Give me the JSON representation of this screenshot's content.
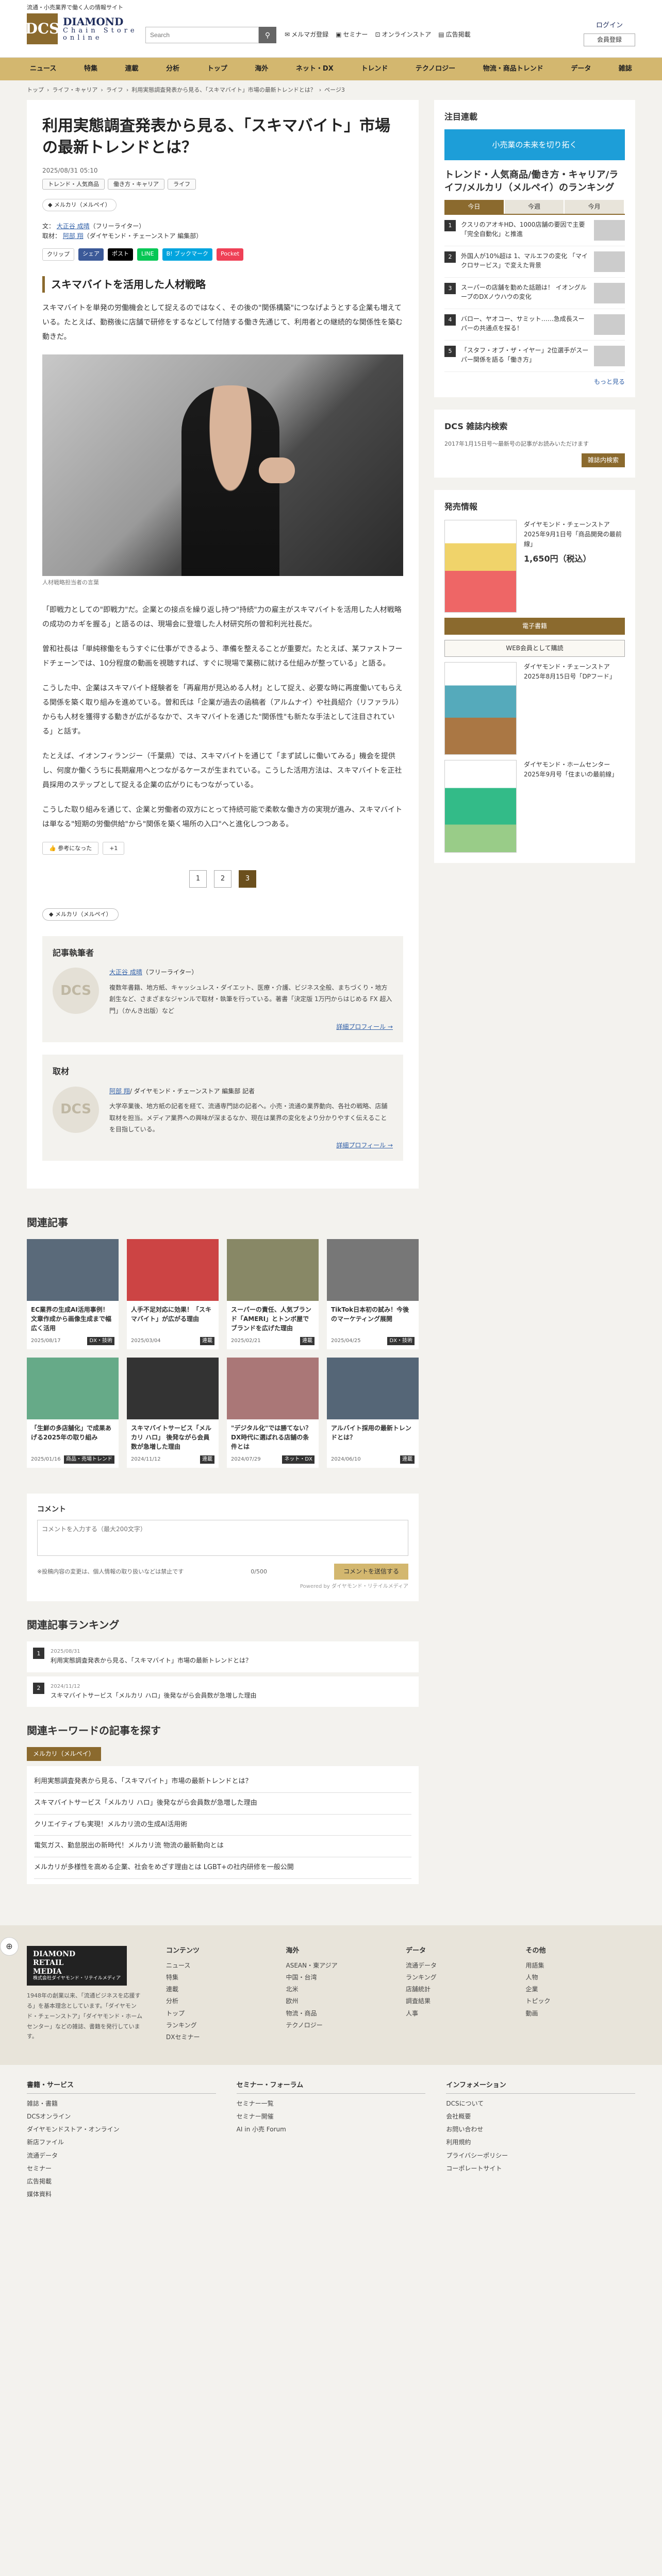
{
  "header": {
    "logo_sub": "流通・小売業界で働く人の情報サイト",
    "logo_mark": "DCS",
    "logo_line1": "DIAMOND",
    "logo_line2": "Chain Store",
    "logo_line3": "online",
    "search_placeholder": "Search",
    "nav": [
      "メルマガ登録",
      "セミナー",
      "オンラインストア",
      "広告掲載"
    ],
    "login": "ログイン",
    "register": "会員登録"
  },
  "gnav": [
    "ニュース",
    "特集",
    "連載",
    "分析",
    "トップ",
    "海外",
    "ネット・DX",
    "トレンド",
    "テクノロジー",
    "物流・商品トレンド",
    "データ",
    "雑誌"
  ],
  "breadcrumb": [
    "トップ",
    "ライフ・キャリア",
    "ライフ",
    "利用実態調査発表から見る、「スキマバイト」市場の最新トレンドとは？",
    "ページ3"
  ],
  "article": {
    "title": "利用実態調査発表から見る、「スキマバイト」市場の最新トレンドとは？",
    "date": "2025/08/31 05:10",
    "tags": [
      "トレンド・人気商品",
      "働き方・キャリア",
      "ライフ"
    ],
    "chip": "メルカリ（メルペイ）",
    "writer_label": "文",
    "writer_name": "大正谷 成晴",
    "writer_role": "（フリーライター）",
    "editor_label": "取材",
    "editor_name": "阿部 翔",
    "editor_role": "（ダイヤモンド・チェーンストア 編集部）",
    "share": [
      "クリップ",
      "シェア",
      "ポスト",
      "LINE",
      "B! ブックマーク",
      "Pocket"
    ],
    "section_title": "スキマバイトを活用した人材戦略",
    "p1": "スキマバイトを単発の労働機会として捉えるのではなく、その後の\"関係構築\"につなげようとする企業も増えている。たとえば、勤務後に店舗で研修をするなどして付随する働き先通じて、利用者との継続的な関係性を築む動きだ。",
    "caption": "人材戦略担当者の言葉",
    "p2": "「即戦力としての\"即戦力\"だ。企業との接点を繰り返し持つ\"持続\"力の雇主がスキマバイトを活用した人材戦略の成功のカギを握る」と語るのは、現場会に登壇した人材研究所の曽和利光社長だ。",
    "p3": "曽和社長は「単純稼働をもうすぐに仕事ができるよう、準備を整えることが重要だ。たとえば、某ファストフードチェーンでは、10分程度の動画を視聴すれば、すぐに現場で業務に就ける仕組みが整っている」と語る。",
    "p4": "こうした中、企業はスキマバイト経験者を「再雇用が見込める人材」として捉え、必要な時に再度働いてもらえる関係を築く取り組みを進めている。曽和氏は「企業が過去の函稿者（アルムナイ）や社員紹介（リファラル）からも人材を獲得する動きが広がるなかで、スキマバイトを通じた\"関係性\"も新たな手法として注目されている」と話す。",
    "p5": "たとえば、イオンフィランジー（千葉県）では、スキマバイトを通じて「まず試しに働いてみる」機会を提供し、何度か働くうちに長期雇用へとつながるケースが生まれている。こうした活用方法は、スキマバイトを正社員採用のステップとして捉える企業の広がりにもつながっている。",
    "p6": "こうした取り組みを通じて、企業と労働者の双方にとって持続可能で柔軟な働き方の実現が進み、スキマバイトは単なる\"短期の労働供給\"から\"関係を築く場所の入口\"へと進化しつつある。",
    "like_btn": "参考になった",
    "like_count": "+1",
    "pages": [
      "1",
      "2",
      "3"
    ],
    "kw_tag": "メルカリ（メルペイ）"
  },
  "author_box": {
    "title": "記事執筆者",
    "name": "大正谷 成晴",
    "role": "（フリーライター）",
    "avatar": "DCS",
    "bio": "複数年書籍、地方紙、キャッシュレス・ダイエット、医療・介護、ビジネス全般、まちづくり・地方創生など、さまざまなジャンルで取材・執筆を行っている。著書「決定版 1万円からはじめる FX 超入門」（かんき出版）など",
    "more": "詳細プロフィール →"
  },
  "editor_box": {
    "title": "取材",
    "name": "阿部 翔",
    "role": "/ ダイヤモンド・チェーンストア 編集部 記者",
    "avatar": "DCS",
    "bio": "大学卒業後、地方紙の記者を経て、流通専門誌の記者へ。小売・流通の業界動向、各社の戦略、店舗取材を担当。メディア業界への興味が深まるなか、現在は業界の変化をより分かりやすく伝えることを目指している。",
    "more": "詳細プロフィール →"
  },
  "sidebar": {
    "serial_title": "注目連載",
    "banner": "小売業の未来を切り拓く",
    "rank_title": "トレンド・人気商品/働き方・キャリア/ライフ/メルカリ（メルペイ）のランキング",
    "tabs": [
      "今日",
      "今週",
      "今月"
    ],
    "ranking": [
      "クスリのアオキHD、1000店舗の要因で主要「完全自動化」と推進",
      "外国人が10%超は 1、マルエフの変化 「マイクロサービス」で変えた背景",
      "スーパーの店舗を勤めた話題は！ イオングループのDXノウハウの変化",
      "バロー、ヤオコー、サミット……急成長スーパーの共通点を探る！",
      "「スタフ・オブ・ザ・イヤー」2位選手がスーパー関係を語る「働き方」"
    ],
    "rank_more": "もっと見る",
    "dcs_title": "DCS 雑誌内検索",
    "dcs_note": "2017年1月15日号〜最新号の記事がお読みいただけます",
    "dcs_btn": "雑誌内検索",
    "sale_title": "発売情報",
    "mag1_title": "ダイヤモンド・チェーンストア 2025年9月1日号「商品開発の最前線」",
    "mag1_price": "1,650円（税込）",
    "mag_buy": "電子書籍",
    "mag_sub": "WEB会員として購読",
    "mag2_title": "ダイヤモンド・チェーンストア 2025年8月15日号「DPフード」",
    "mag3_title": "ダイヤモンド・ホームセンター 2025年9月号「住まいの最前線」"
  },
  "related": {
    "title": "関連記事",
    "cards": [
      {
        "title": "EC業界の生成AI活用事例！文章作成から画像生成まで幅広く活用",
        "date": "2025/08/17",
        "tag": "DX・技術"
      },
      {
        "title": "人手不足対応に効果！「スキマバイト」が広がる理由",
        "date": "2025/03/04",
        "tag": "連載"
      },
      {
        "title": "スーパーの責任、人気ブランド「AMERI」とトンボ屋でブランドを広げた理由",
        "date": "2025/02/21",
        "tag": "連載"
      },
      {
        "title": "TikTok日本初の試み！今後のマーケティング展開",
        "date": "2025/04/25",
        "tag": "DX・技術"
      },
      {
        "title": "「生鮮の多店舗化」で成果あげる2025年の取り組み",
        "date": "2025/01/16",
        "tag": "商品・売場トレンド"
      },
      {
        "title": "スキマバイトサービス「メルカリ ハロ」 後発ながら会員数が急増した理由",
        "date": "2024/11/12",
        "tag": "連載"
      },
      {
        "title": "\"デジタル化\"では勝てない？ DX時代に選ばれる店舗の条件とは",
        "date": "2024/07/29",
        "tag": "ネット・DX"
      },
      {
        "title": "アルバイト採用の最新トレンドとは？",
        "date": "2024/06/10",
        "tag": "連載"
      }
    ]
  },
  "comment": {
    "title": "コメント",
    "placeholder": "コメントを入力する（最大200文字）",
    "note": "※投稿内容の変更は、個人情報の取り扱いなどは禁止です",
    "counter": "0/500",
    "button": "コメントを送信する",
    "powered": "Powered by ダイヤモンド・リテイルメディア"
  },
  "cat_rank": {
    "title": "関連記事ランキング",
    "items": [
      {
        "date": "2025/08/31",
        "text": "利用実態調査発表から見る、「スキマバイト」市場の最新トレンドとは？"
      },
      {
        "date": "2024/11/12",
        "text": "スキマバイトサービス「メルカリ ハロ」後発ながら会員数が急増した理由"
      }
    ]
  },
  "keywords": {
    "title": "関連キーワードの記事を探す",
    "tag": "メルカリ（メルペイ）",
    "items": [
      "利用実態調査発表から見る、「スキマバイト」市場の最新トレンドとは？",
      "スキマバイトサービス「メルカリ ハロ」後発ながら会員数が急増した理由",
      "クリエイティブも実現！メルカリ流の生成AI活用術",
      "電気ガス、勤怠脱出の新時代！メルカリ流 物流の最新動向とは",
      "メルカリが多様性を高める企業、社会をめざす理由とは LGBT+の社内研修を一般公開"
    ]
  },
  "footer": {
    "logo1": "DIAMOND",
    "logo2": "RETAIL",
    "logo3": "MEDIA",
    "company": "株式会社ダイヤモンド・リテイルメディア",
    "desc": "1948年の創業以来、「流通ビジネスを応援する」を基本理念としています。「ダイヤモンド・チェーンストア」「ダイヤモンド・ホームセンター」などの雑誌、書籍を発行しています。",
    "cols": [
      {
        "h": "コンテンツ",
        "items": [
          "ニュース",
          "特集",
          "連載",
          "分析",
          "トップ",
          "ランキング",
          "DXセミナー"
        ]
      },
      {
        "h": "海外",
        "items": [
          "ASEAN・東アジア",
          "中国・台湾",
          "北米",
          "欧州",
          "物流・商品",
          "テクノロジー"
        ]
      },
      {
        "h": "データ",
        "items": [
          "流通データ",
          "ランキング",
          "店舗統計",
          "調査結果",
          "人事"
        ]
      },
      {
        "h": "その他",
        "items": [
          "用語集",
          "人物",
          "企業",
          "トピック",
          "動画"
        ]
      }
    ],
    "c2": [
      {
        "h": "書籍・サービス",
        "items": [
          "雑誌・書籍",
          "DCSオンライン",
          "ダイヤモンドストア・オンライン",
          "新店ファイル",
          "流通データ",
          "セミナー",
          "広告掲載",
          "媒体資料"
        ]
      },
      {
        "h": "セミナー・フォーラム",
        "items": [
          "セミナー一覧",
          "セミナー開催",
          "AI in 小売 Forum"
        ]
      },
      {
        "h": "インフォメーション",
        "items": [
          "DCSについて",
          "会社概要",
          "お問い合わせ",
          "利用規約",
          "プライバシーポリシー",
          "コーポレートサイト"
        ]
      }
    ]
  }
}
